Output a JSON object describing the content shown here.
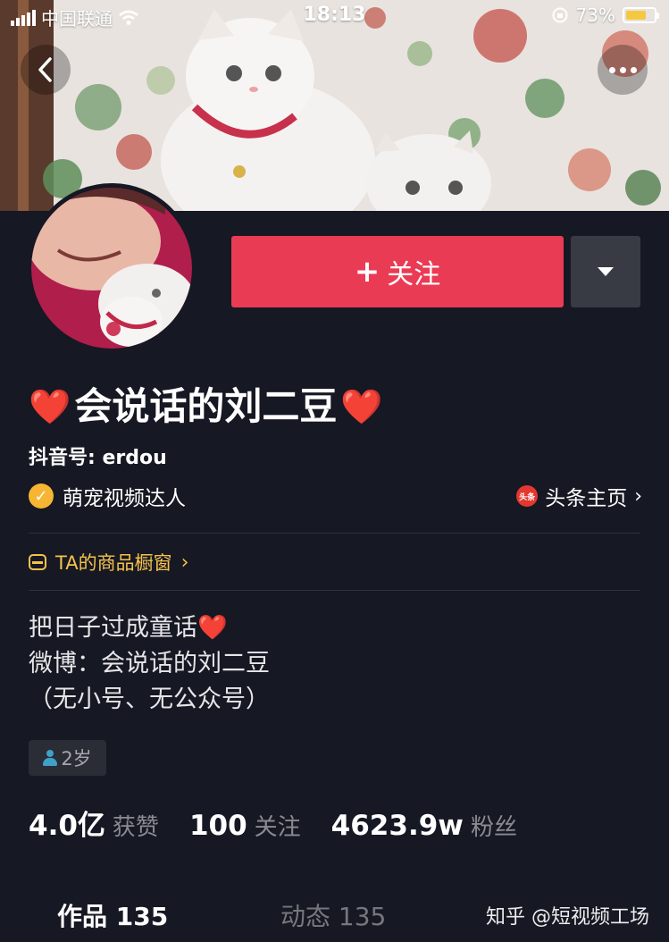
{
  "status_bar": {
    "carrier": "中国联通",
    "time": "18:13",
    "battery_percent": "73%",
    "battery_level": 0.73
  },
  "profile": {
    "name": "会说话的刘二豆",
    "name_heart": "❤️",
    "douyin_id": "抖音号: erdou",
    "verification": "萌宠视频达人",
    "toutiao_link": "头条主页",
    "toutiao_icon_text": "头条",
    "shop_link": "TA的商品橱窗",
    "bio": [
      "把日子过成童话❤️",
      "微博：会说话的刘二豆",
      "（无小号、无公众号）"
    ],
    "age": "2岁"
  },
  "actions": {
    "follow_label": "关注",
    "follow_plus": "+"
  },
  "stats": [
    {
      "value": "4.0亿",
      "label": "获赞"
    },
    {
      "value": "100",
      "label": "关注"
    },
    {
      "value": "4623.9w",
      "label": "粉丝"
    }
  ],
  "tabs": [
    {
      "label": "作品 135"
    },
    {
      "label": "动态 135"
    }
  ],
  "watermark": "知乎 @短视频工场",
  "colors": {
    "background": "#161823",
    "follow_button": "#ea3b55",
    "shop_accent": "#f5c24b",
    "verify_badge": "#f6b532"
  }
}
